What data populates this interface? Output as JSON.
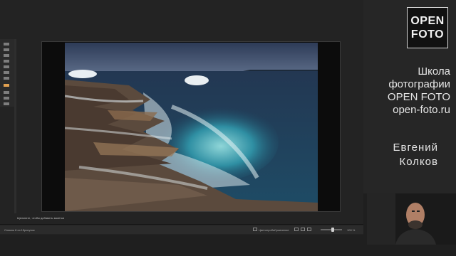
{
  "editor": {
    "hint": "Щелкните, чтобы добавить заметки",
    "status": {
      "left": "Снимок 8 из 15",
      "center": "рисунок",
      "soft_proof": "Цветопроба",
      "view": "Сравнение",
      "zoom": "100 %"
    }
  },
  "branding": {
    "logo_top": "OPEN",
    "logo_bottom": "FOTO",
    "school_lines": [
      "Школа",
      "фотографии",
      "OPEN FOTO",
      "open-foto.ru"
    ],
    "author_lines": [
      "Евгений",
      "Колков"
    ]
  },
  "colors": {
    "accent": "#e0a050",
    "panel": "#232323",
    "brand_text": "#e6e6e6"
  }
}
